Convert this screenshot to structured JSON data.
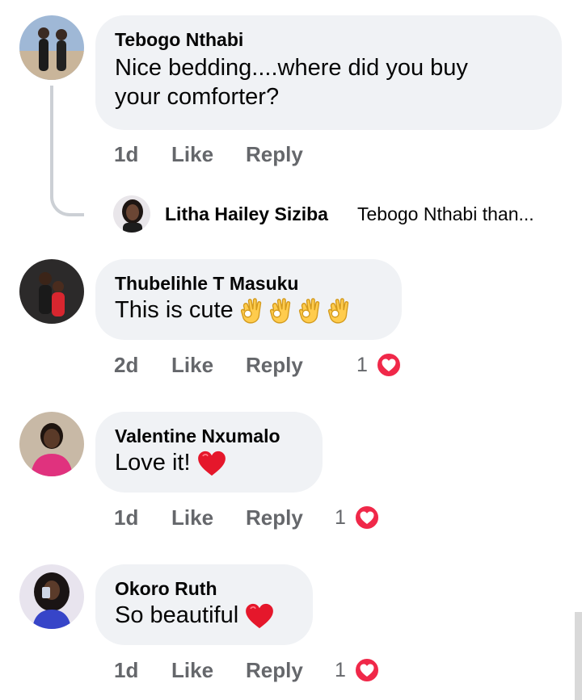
{
  "comments": [
    {
      "author": "Tebogo Nthabi",
      "text_lines": [
        "Nice bedding....where did you buy",
        "your comforter?"
      ],
      "time": "1d",
      "like_label": "Like",
      "reply_label": "Reply",
      "reaction_count": "",
      "reply": {
        "author": "Litha Hailey Siziba",
        "preview": "Tebogo Nthabi than..."
      }
    },
    {
      "author": "Thubelihle T Masuku",
      "text": "This is cute",
      "emoji": "ok-hand-icon x4",
      "time": "2d",
      "like_label": "Like",
      "reply_label": "Reply",
      "reaction_count": "1"
    },
    {
      "author": "Valentine Nxumalo",
      "text": "Love it!",
      "emoji": "red-heart-icon",
      "time": "1d",
      "like_label": "Like",
      "reply_label": "Reply",
      "reaction_count": "1"
    },
    {
      "author": "Okoro Ruth",
      "text": "So beautiful",
      "emoji": "red-heart-icon",
      "time": "1d",
      "like_label": "Like",
      "reply_label": "Reply",
      "reaction_count": "1"
    }
  ],
  "colors": {
    "bubble_bg": "#f0f2f5",
    "meta_text": "#65676b",
    "love_reaction": "#f02849",
    "heart_emoji": "#e5172b"
  }
}
